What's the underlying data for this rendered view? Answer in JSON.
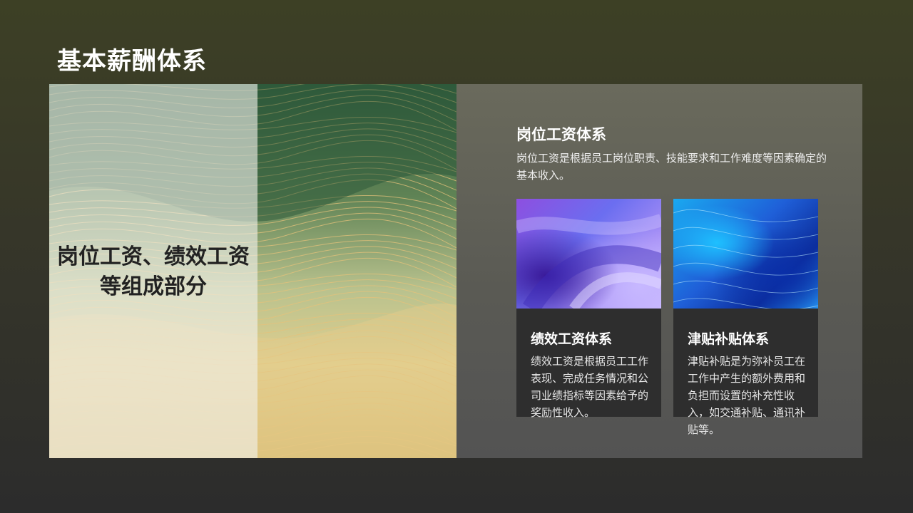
{
  "slide": {
    "title": "基本薪酬体系",
    "left_panel": {
      "overlay_text": "岗位工资、绩效工资等组成部分"
    },
    "main_section": {
      "heading": "岗位工资体系",
      "description": "岗位工资是根据员工岗位职责、技能要求和工作难度等因素确定的基本收入。"
    },
    "cards": [
      {
        "title": "绩效工资体系",
        "description": "绩效工资是根据员工工作表现、完成任务情况和公司业绩指标等因素给予的奖励性收入。"
      },
      {
        "title": "津贴补贴体系",
        "description": "津贴补贴是为弥补员工在工作中产生的额外费用和负担而设置的补充性收入，如交通补贴、通讯补贴等。"
      }
    ]
  },
  "colors": {
    "background_top": "#3d4025",
    "background_bottom": "#2c2c2c",
    "right_panel": "#5e5e56",
    "card_background": "#2e2e2e",
    "text_primary": "#ffffff"
  }
}
